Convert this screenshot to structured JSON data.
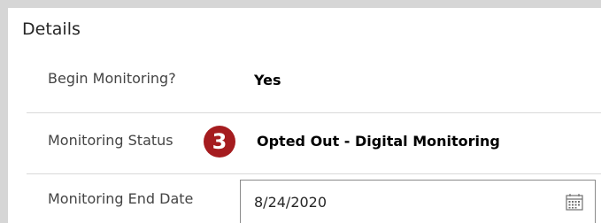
{
  "section": {
    "title": "Details"
  },
  "fields": {
    "begin_monitoring": {
      "label": "Begin Monitoring?",
      "value": "Yes"
    },
    "monitoring_status": {
      "label": "Monitoring Status",
      "badge": "3",
      "value": "Opted Out - Digital Monitoring"
    },
    "monitoring_end_date": {
      "label": "Monitoring End Date",
      "value": "8/24/2020",
      "icon": "calendar-icon"
    }
  },
  "colors": {
    "badge_background": "#a51c1f",
    "page_background": "#d6d6d6",
    "card_background": "#ffffff",
    "divider": "#d9d9d9"
  }
}
